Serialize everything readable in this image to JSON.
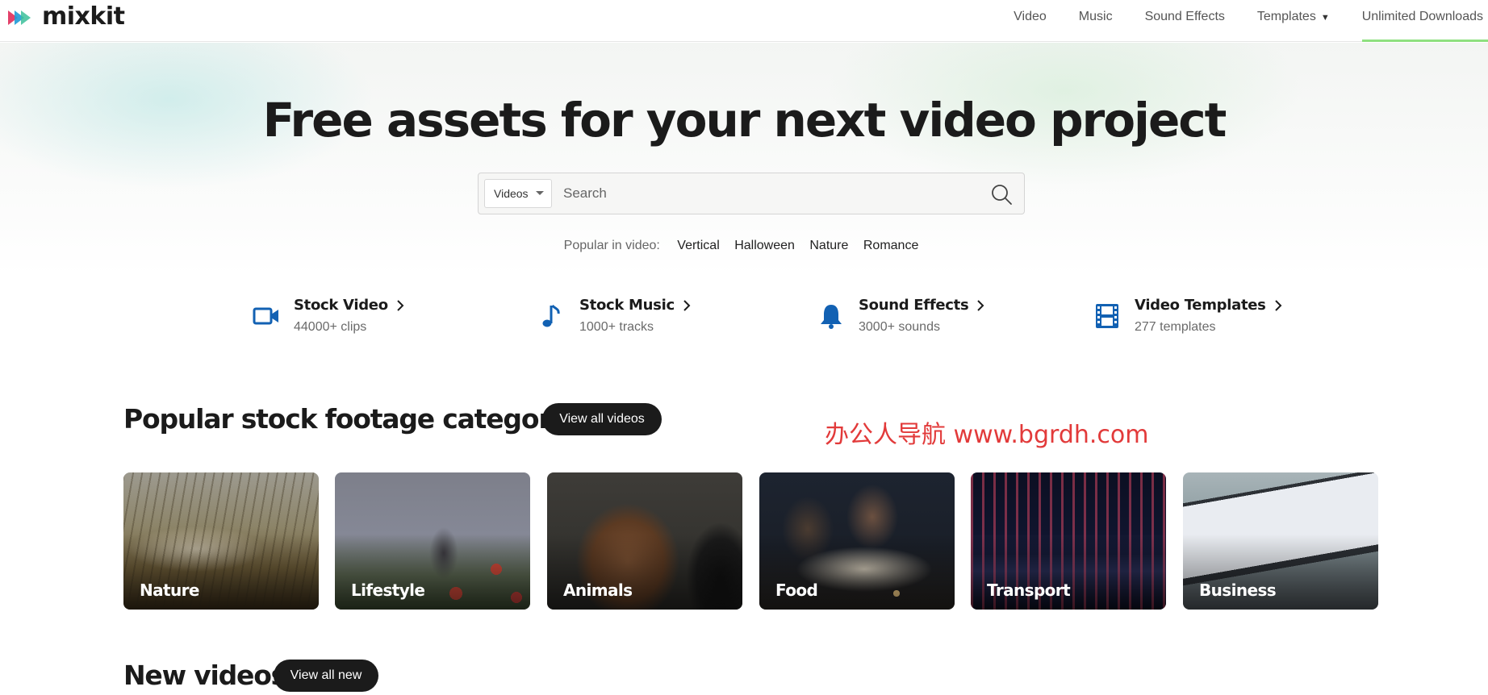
{
  "brand": {
    "name": "mixkit"
  },
  "nav": {
    "items": [
      {
        "label": "Video"
      },
      {
        "label": "Music"
      },
      {
        "label": "Sound Effects"
      },
      {
        "label": "Templates"
      },
      {
        "label": "Unlimited Downloads"
      }
    ]
  },
  "hero": {
    "title": "Free assets for your next video project",
    "search": {
      "category": "Videos",
      "placeholder": "Search"
    },
    "popular_label": "Popular in video:",
    "popular_tags": [
      "Vertical",
      "Halloween",
      "Nature",
      "Romance"
    ]
  },
  "assets": [
    {
      "title": "Stock Video",
      "sub": "44000+ clips",
      "icon": "video-camera-icon"
    },
    {
      "title": "Stock Music",
      "sub": "1000+ tracks",
      "icon": "music-note-icon"
    },
    {
      "title": "Sound Effects",
      "sub": "3000+ sounds",
      "icon": "bell-icon"
    },
    {
      "title": "Video Templates",
      "sub": "277 templates",
      "icon": "film-strip-icon"
    }
  ],
  "popular_section": {
    "title": "Popular stock footage categories",
    "button": "View all videos",
    "categories": [
      "Nature",
      "Lifestyle",
      "Animals",
      "Food",
      "Transport",
      "Business"
    ]
  },
  "watermark": "办公人导航  www.bgrdh.com",
  "new_section": {
    "title": "New videos",
    "button": "View all new"
  },
  "colors": {
    "accent_blue": "#1261b3",
    "nav_underline": "#8fe080",
    "pill": "#1b1b1b",
    "watermark": "#e23a3a"
  }
}
